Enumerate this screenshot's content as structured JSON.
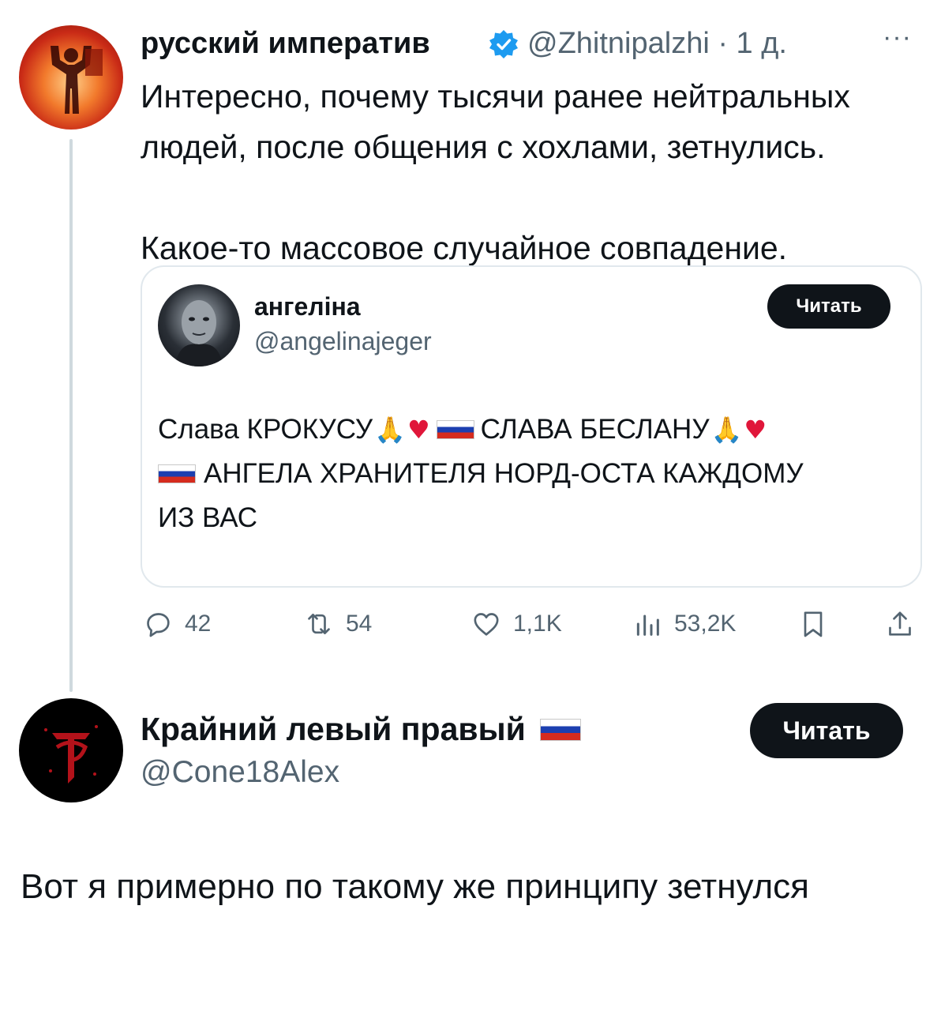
{
  "tweet": {
    "author_name": "русский императив",
    "meta": "@Zhitnipalzhi · 1 д.",
    "more": "···",
    "text": "Интересно, почему тысячи ранее нейтральных людей, после общения с хохлами, зетнулись.\n\nКакое-то массовое случайное совпадение.",
    "quote": {
      "name": "ангеліна",
      "handle": "@angelinajeger",
      "follow_label": "Читать",
      "line1_a": "Слава КРОКУСУ",
      "line1_b": "СЛАВА БЕСЛАНУ",
      "line2": "АНГЕЛА ХРАНИТЕЛЯ НОРД-ОСТА КАЖДОМУ",
      "line3": "ИЗ ВАС",
      "emoji_pray": "🙏",
      "emoji_heart": "♥"
    },
    "actions": {
      "replies": "42",
      "reposts": "54",
      "likes": "1,1K",
      "views": "53,2K"
    }
  },
  "reply": {
    "author_name": "Крайний левый правый",
    "handle": "@Cone18Alex",
    "follow_label": "Читать",
    "text": "Вот я примерно по такому же принципу зетнулся"
  },
  "colors": {
    "accent_verified": "#1d9bf0",
    "text_primary": "#0f1419",
    "text_secondary": "#536471",
    "flag_white": "#ffffff",
    "flag_blue": "#1c3fb0",
    "flag_red": "#d52b1e"
  },
  "icons": [
    "verified-badge-icon",
    "more-icon",
    "reply-icon",
    "repost-icon",
    "like-icon",
    "views-icon",
    "bookmark-icon",
    "share-icon",
    "flag-icon",
    "pray-emoji",
    "heart-emoji"
  ]
}
